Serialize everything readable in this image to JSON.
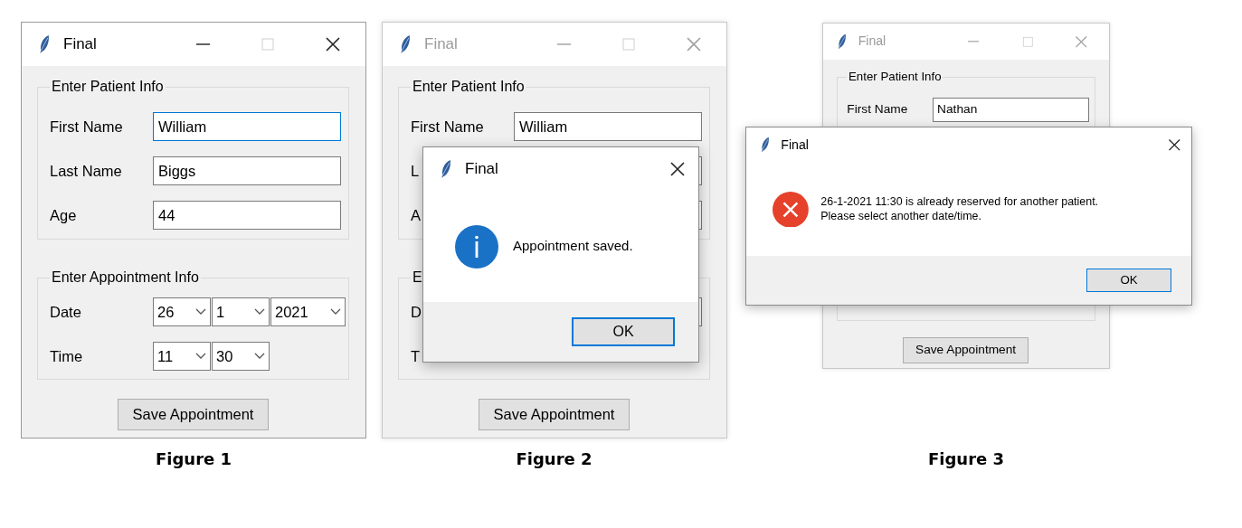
{
  "figures": [
    {
      "caption": "Figure 1",
      "window": {
        "title": "Final",
        "active": true,
        "groups": [
          {
            "title": "Enter Patient Info",
            "rows": [
              {
                "kind": "entry",
                "label": "First Name",
                "value": "William",
                "focused": true
              },
              {
                "kind": "entry",
                "label": "Last Name",
                "value": "Biggs",
                "focused": false
              },
              {
                "kind": "entry",
                "label": "Age",
                "value": "44",
                "focused": false
              }
            ]
          },
          {
            "title": "Enter Appointment Info",
            "rows": [
              {
                "kind": "combos",
                "label": "Date",
                "values": [
                  "26",
                  "1",
                  "2021"
                ]
              },
              {
                "kind": "combos",
                "label": "Time",
                "values": [
                  "11",
                  "30"
                ]
              }
            ]
          }
        ],
        "button": "Save Appointment"
      }
    },
    {
      "caption": "Figure 2",
      "window": {
        "title": "Final",
        "active": false,
        "groups": [
          {
            "title": "Enter Patient Info",
            "rows": [
              {
                "kind": "entry",
                "label": "First Name",
                "value": "William",
                "focused": false
              },
              {
                "kind": "entry",
                "label": "L"
              },
              {
                "kind": "entry",
                "label": "A"
              }
            ]
          },
          {
            "title": "E",
            "rows": [
              {
                "kind": "entry",
                "label": "D"
              },
              {
                "kind": "label",
                "label": "T"
              }
            ]
          }
        ],
        "button": "Save Appointment",
        "dialog": {
          "title": "Final",
          "kind": "info",
          "message": "Appointment saved.",
          "ok": "OK"
        }
      }
    },
    {
      "caption": "Figure 3",
      "window": {
        "title": "Final",
        "active": false,
        "groups": [
          {
            "title": "Enter Patient Info",
            "rows": [
              {
                "kind": "entry",
                "label": "First Name",
                "value": "Nathan",
                "focused": false
              },
              {
                "kind": "blank"
              },
              {
                "kind": "blank"
              }
            ]
          },
          {
            "rows": [
              {
                "kind": "blank"
              },
              {
                "kind": "blank"
              }
            ]
          }
        ],
        "button": "Save Appointment",
        "dialog": {
          "title": "Final",
          "kind": "error",
          "message": "26-1-2021 11:30 is already reserved for another patient.\nPlease select another date/time.",
          "ok": "OK"
        }
      }
    }
  ]
}
